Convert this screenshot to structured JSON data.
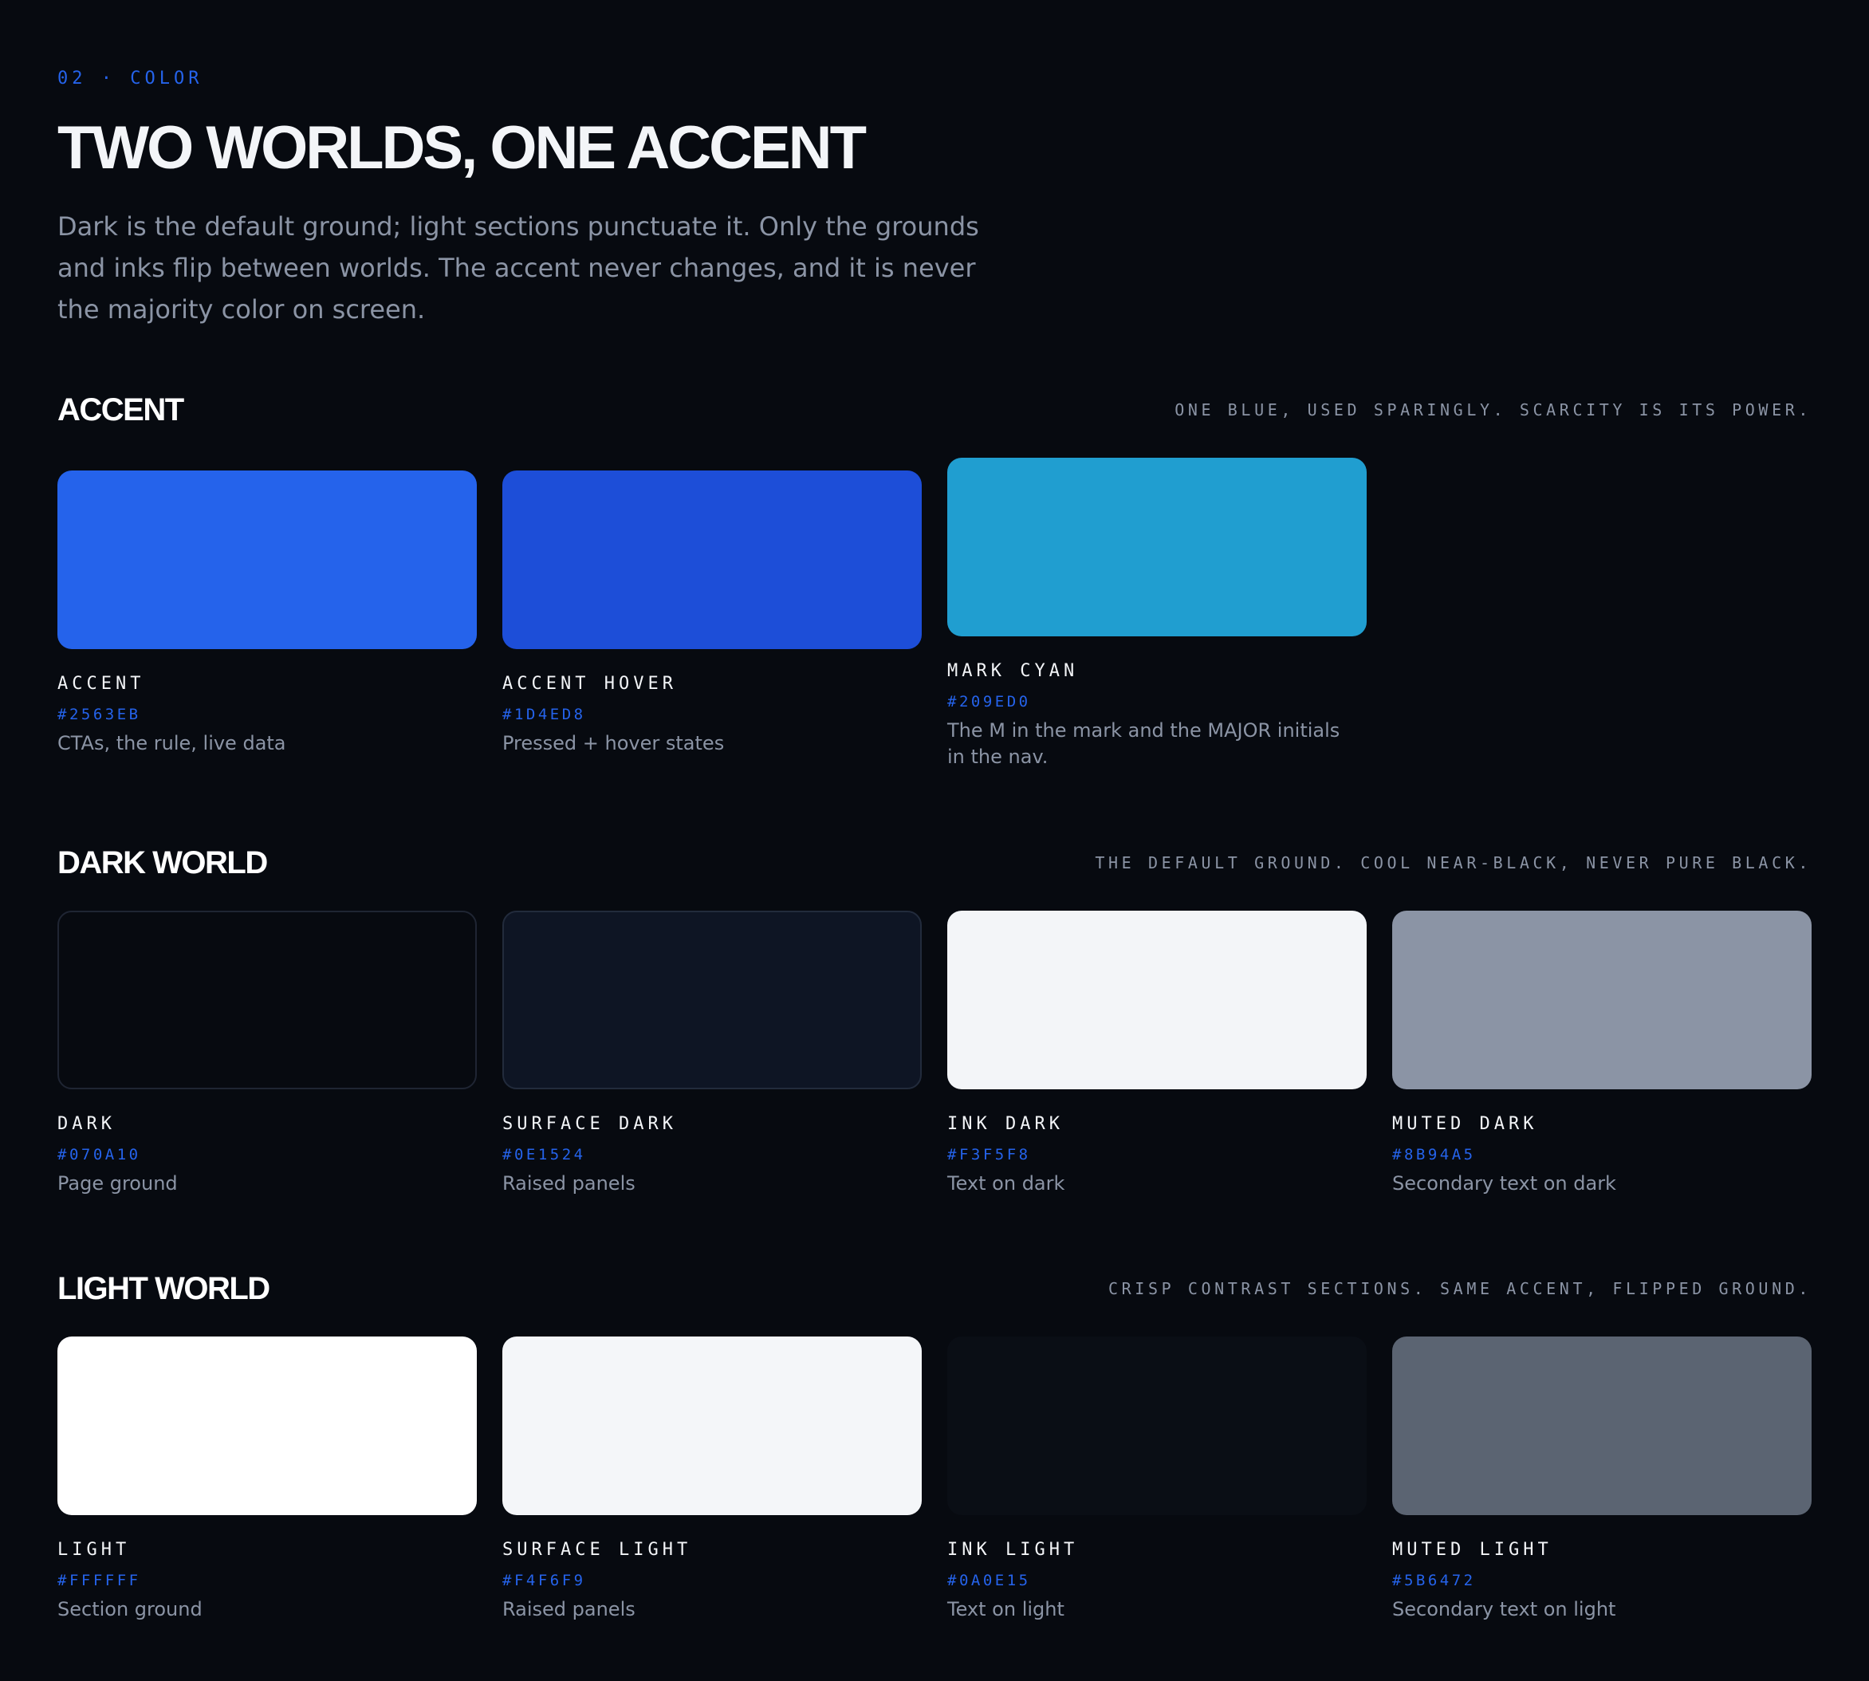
{
  "header": {
    "eyebrow": "02 · COLOR",
    "title": "TWO WORLDS, ONE ACCENT",
    "lede": "Dark is the default ground; light sections punctuate it. Only the grounds and inks flip between worlds. The accent never changes, and it is never the majority color on screen."
  },
  "sections": {
    "accent": {
      "title": "ACCENT",
      "note": "ONE BLUE, USED SPARINGLY. SCARCITY IS ITS POWER.",
      "swatches": [
        {
          "name": "ACCENT",
          "hex": "#2563EB",
          "desc": "CTAs, the rule, live data",
          "color": "#2563EB"
        },
        {
          "name": "ACCENT HOVER",
          "hex": "#1D4ED8",
          "desc": "Pressed + hover states",
          "color": "#1D4ED8"
        },
        {
          "name": "MARK CYAN",
          "hex": "#209ED0",
          "desc": "The M in the mark and the MAJOR initials in the nav.",
          "color": "#209ED0"
        }
      ]
    },
    "dark": {
      "title": "DARK WORLD",
      "note": "THE DEFAULT GROUND. COOL NEAR-BLACK, NEVER PURE BLACK.",
      "swatches": [
        {
          "name": "DARK",
          "hex": "#070A10",
          "desc": "Page ground",
          "color": "#070A10"
        },
        {
          "name": "SURFACE DARK",
          "hex": "#0E1524",
          "desc": "Raised panels",
          "color": "#0E1524"
        },
        {
          "name": "INK DARK",
          "hex": "#F3F5F8",
          "desc": "Text on dark",
          "color": "#F3F5F8"
        },
        {
          "name": "MUTED DARK",
          "hex": "#8B94A5",
          "desc": "Secondary text on dark",
          "color": "#8B94A5"
        }
      ]
    },
    "light": {
      "title": "LIGHT WORLD",
      "note": "CRISP CONTRAST SECTIONS. SAME ACCENT, FLIPPED GROUND.",
      "swatches": [
        {
          "name": "LIGHT",
          "hex": "#FFFFFF",
          "desc": "Section ground",
          "color": "#FFFFFF"
        },
        {
          "name": "SURFACE LIGHT",
          "hex": "#F4F6F9",
          "desc": "Raised panels",
          "color": "#F4F6F9"
        },
        {
          "name": "INK LIGHT",
          "hex": "#0A0E15",
          "desc": "Text on light",
          "color": "#0A0E15"
        },
        {
          "name": "MUTED LIGHT",
          "hex": "#5B6472",
          "desc": "Secondary text on light",
          "color": "#5B6472"
        }
      ]
    }
  }
}
